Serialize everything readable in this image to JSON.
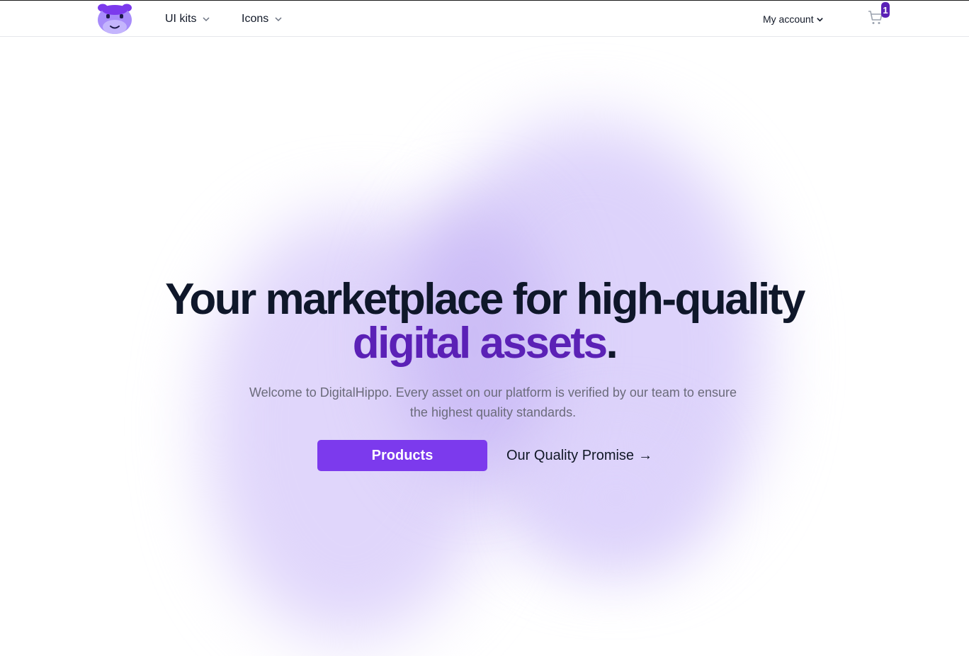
{
  "nav": {
    "logo": "hippo-logo",
    "items": [
      {
        "label": "UI kits",
        "icon": "chevron-down-icon"
      },
      {
        "label": "Icons",
        "icon": "chevron-down-icon"
      }
    ],
    "account_label": "My account",
    "cart_count": "1"
  },
  "hero": {
    "headline_line1": "Your marketplace for high-quality",
    "headline_accent": "digital assets",
    "headline_end": ".",
    "subtitle": "Welcome to DigitalHippo. Every asset on our platform is verified by our team to ensure the highest quality standards.",
    "primary_button": "Products",
    "secondary_button": "Our Quality Promise",
    "secondary_arrow": "→"
  },
  "colors": {
    "accent": "#7c3aed",
    "accent_dark": "#5b21b6",
    "text": "#0f172a",
    "blob": "#ddd3fb"
  }
}
